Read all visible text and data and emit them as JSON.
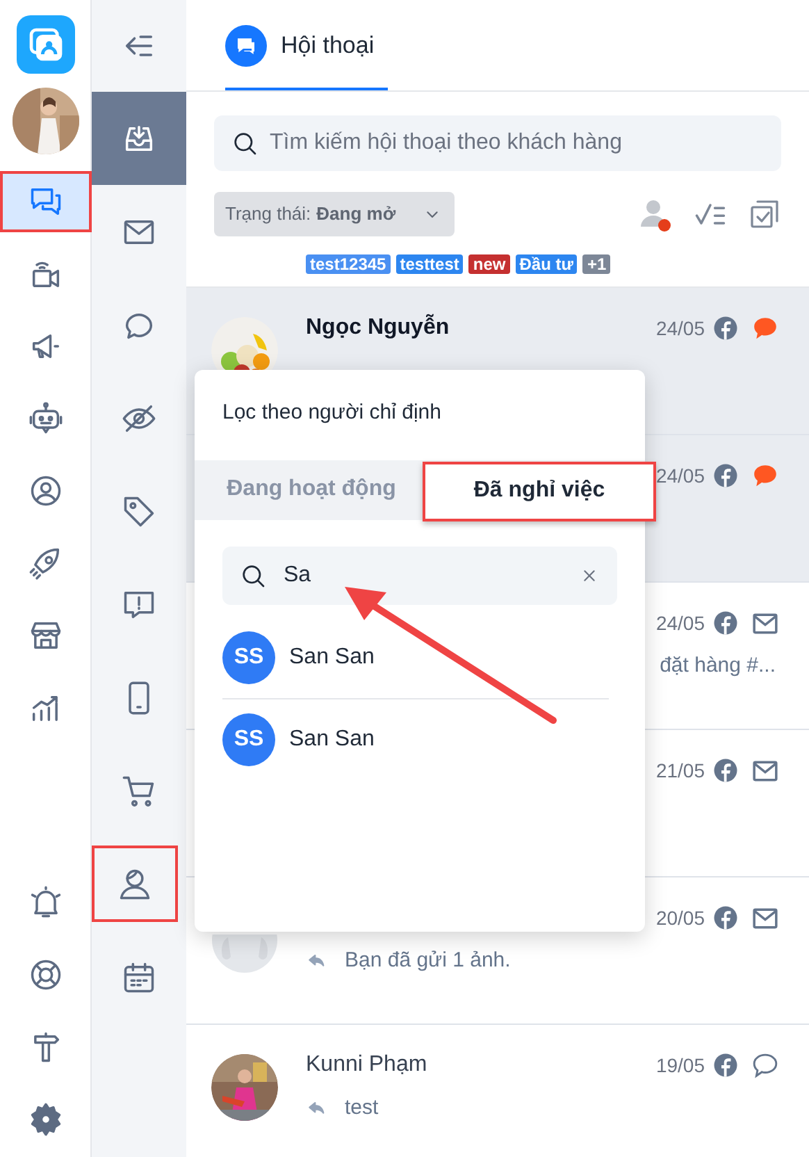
{
  "rail": {
    "items": [
      {
        "selected": true,
        "highlighted": true
      },
      {
        "selected": false,
        "highlighted": false
      },
      {
        "selected": false,
        "highlighted": false
      },
      {
        "selected": false,
        "highlighted": false
      },
      {
        "selected": false,
        "highlighted": false
      },
      {
        "selected": false,
        "highlighted": false
      },
      {
        "selected": false,
        "highlighted": false
      },
      {
        "selected": false,
        "highlighted": false
      }
    ],
    "bottom_items": [
      {
        "selected": false
      },
      {
        "selected": false
      },
      {
        "selected": false
      },
      {
        "selected": false
      }
    ]
  },
  "filters_rail": {
    "items": [
      {
        "selected": true,
        "highlighted": false
      },
      {
        "selected": false,
        "highlighted": false
      },
      {
        "selected": false,
        "highlighted": false
      },
      {
        "selected": false,
        "highlighted": false
      },
      {
        "selected": false,
        "highlighted": false
      },
      {
        "selected": false,
        "highlighted": false
      },
      {
        "selected": false,
        "highlighted": false
      },
      {
        "selected": false,
        "highlighted": false
      },
      {
        "selected": false,
        "highlighted": true
      },
      {
        "selected": false,
        "highlighted": false
      }
    ]
  },
  "header": {
    "tab": {
      "label": "Hội thoại",
      "selected": true
    }
  },
  "search": {
    "placeholder": "Tìm kiếm hội thoại theo khách hàng"
  },
  "status_filter": {
    "label": "Trạng thái:",
    "value": "Đang mở"
  },
  "tags": [
    {
      "label": "test12345",
      "color": "#4a90f2"
    },
    {
      "label": "testtest",
      "color": "#2d86f0"
    },
    {
      "label": "new",
      "color": "#c53030"
    },
    {
      "label": "Đầu tư",
      "color": "#2d86f0"
    },
    {
      "label": "+1",
      "color": "#7d8797"
    }
  ],
  "conversations": [
    {
      "name": "Ngọc Nguyễn",
      "date": "24/05",
      "kind": "chat",
      "unread": true,
      "selected": true
    },
    {
      "date": "24/05",
      "kind": "chat",
      "unread": true,
      "selected": true
    },
    {
      "date": "24/05",
      "kind": "mail",
      "selected": false,
      "preview": "đặt hàng #...",
      "partial": true
    },
    {
      "date": "21/05",
      "kind": "mail",
      "selected": false
    },
    {
      "date": "20/05",
      "kind": "mail",
      "selected": false,
      "avatar": {
        "kind": "default"
      },
      "preview": "Bạn đã gửi 1 ảnh.",
      "replied": true
    },
    {
      "name": "Kunni Phạm",
      "date": "19/05",
      "kind": "chat",
      "unread": false,
      "selected": false,
      "preview": "test",
      "replied": true
    }
  ],
  "assignee_popup": {
    "title": "Lọc theo người chỉ định",
    "tabs": [
      {
        "label": "Đang hoạt động",
        "selected": false,
        "highlighted": false
      },
      {
        "label": "Đã nghỉ việc",
        "selected": true,
        "highlighted": true
      }
    ],
    "search": {
      "value": "Sa",
      "arrow": true
    },
    "results": [
      {
        "initials": "SS",
        "name": "San San"
      },
      {
        "initials": "SS",
        "name": "San San"
      }
    ]
  }
}
